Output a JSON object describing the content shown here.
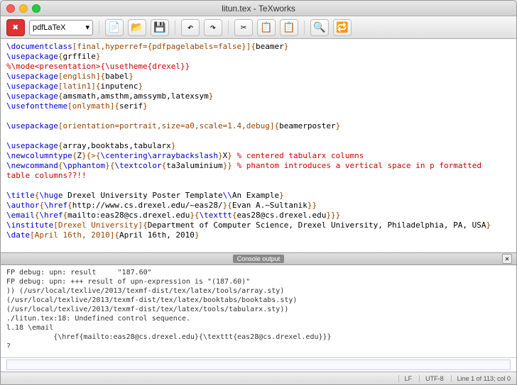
{
  "window": {
    "title": "litun.tex - TeXworks"
  },
  "toolbar": {
    "engine": "pdfLaTeX"
  },
  "editor_lines": [
    [
      {
        "t": "\\documentclass",
        "c": "cmd"
      },
      {
        "t": "[final,hyperref={pdfpagelabels=false}]{",
        "c": "struct"
      },
      {
        "t": "beamer",
        "c": ""
      },
      {
        "t": "}",
        "c": "struct"
      }
    ],
    [
      {
        "t": "\\usepackage",
        "c": "cmd"
      },
      {
        "t": "{",
        "c": "struct"
      },
      {
        "t": "grffile",
        "c": ""
      },
      {
        "t": "}",
        "c": "struct"
      }
    ],
    [
      {
        "t": "%\\mode<presentation>{\\usetheme{drexel}}",
        "c": "comment"
      }
    ],
    [
      {
        "t": "\\usepackage",
        "c": "cmd"
      },
      {
        "t": "[english]{",
        "c": "struct"
      },
      {
        "t": "babel",
        "c": ""
      },
      {
        "t": "}",
        "c": "struct"
      }
    ],
    [
      {
        "t": "\\usepackage",
        "c": "cmd"
      },
      {
        "t": "[latin1]{",
        "c": "struct"
      },
      {
        "t": "inputenc",
        "c": ""
      },
      {
        "t": "}",
        "c": "struct"
      }
    ],
    [
      {
        "t": "\\usepackage",
        "c": "cmd"
      },
      {
        "t": "{",
        "c": "struct"
      },
      {
        "t": "amsmath,amsthm,amssymb,latexsym",
        "c": ""
      },
      {
        "t": "}",
        "c": "struct"
      }
    ],
    [
      {
        "t": "\\usefonttheme",
        "c": "cmd"
      },
      {
        "t": "[onlymath]{",
        "c": "struct"
      },
      {
        "t": "serif",
        "c": ""
      },
      {
        "t": "}",
        "c": "struct"
      }
    ],
    [],
    [
      {
        "t": "\\usepackage",
        "c": "cmd"
      },
      {
        "t": "[orientation=portrait,size=a0,scale=1.4,debug]{",
        "c": "struct"
      },
      {
        "t": "beamerposter",
        "c": ""
      },
      {
        "t": "}",
        "c": "struct"
      }
    ],
    [],
    [
      {
        "t": "\\usepackage",
        "c": "cmd"
      },
      {
        "t": "{",
        "c": "struct"
      },
      {
        "t": "array,booktabs,tabularx",
        "c": ""
      },
      {
        "t": "}",
        "c": "struct"
      }
    ],
    [
      {
        "t": "\\newcolumntype",
        "c": "cmd"
      },
      {
        "t": "{",
        "c": "struct"
      },
      {
        "t": "Z",
        "c": ""
      },
      {
        "t": "}{>{",
        "c": "struct"
      },
      {
        "t": "\\centering\\arraybackslash",
        "c": "cmd"
      },
      {
        "t": "}",
        "c": "struct"
      },
      {
        "t": "X",
        "c": ""
      },
      {
        "t": "} ",
        "c": "struct"
      },
      {
        "t": "% centered tabularx columns",
        "c": "comment"
      }
    ],
    [
      {
        "t": "\\newcommand",
        "c": "cmd"
      },
      {
        "t": "{",
        "c": "struct"
      },
      {
        "t": "\\pphantom",
        "c": "cmd"
      },
      {
        "t": "}{",
        "c": "struct"
      },
      {
        "t": "\\textcolor",
        "c": "cmd"
      },
      {
        "t": "{",
        "c": "struct"
      },
      {
        "t": "ta3aluminium",
        "c": ""
      },
      {
        "t": "}} ",
        "c": "struct"
      },
      {
        "t": "% phantom introduces a vertical space in p formatted",
        "c": "comment"
      }
    ],
    [
      {
        "t": "table columns??!!",
        "c": "comment"
      }
    ],
    [],
    [
      {
        "t": "\\title",
        "c": "cmd"
      },
      {
        "t": "{",
        "c": "struct"
      },
      {
        "t": "\\huge",
        "c": "cmd"
      },
      {
        "t": " Drexel University Poster Template",
        "c": ""
      },
      {
        "t": "\\\\",
        "c": "cmd"
      },
      {
        "t": "An Example",
        "c": ""
      },
      {
        "t": "}",
        "c": "struct"
      }
    ],
    [
      {
        "t": "\\author",
        "c": "cmd"
      },
      {
        "t": "{",
        "c": "struct"
      },
      {
        "t": "\\href",
        "c": "cmd"
      },
      {
        "t": "{",
        "c": "struct"
      },
      {
        "t": "http://www.cs.drexel.edu/~eas28/",
        "c": ""
      },
      {
        "t": "}{",
        "c": "struct"
      },
      {
        "t": "Evan A.~Sultanik",
        "c": ""
      },
      {
        "t": "}}",
        "c": "struct"
      }
    ],
    [
      {
        "t": "\\email",
        "c": "cmd"
      },
      {
        "t": "{",
        "c": "struct"
      },
      {
        "t": "\\href",
        "c": "cmd"
      },
      {
        "t": "{",
        "c": "struct"
      },
      {
        "t": "mailto:eas28@cs.drexel.edu",
        "c": ""
      },
      {
        "t": "}{",
        "c": "struct"
      },
      {
        "t": "\\texttt",
        "c": "cmd"
      },
      {
        "t": "{",
        "c": "struct"
      },
      {
        "t": "eas28@cs.drexel.edu",
        "c": ""
      },
      {
        "t": "}}}",
        "c": "struct"
      }
    ],
    [
      {
        "t": "\\institute",
        "c": "cmd"
      },
      {
        "t": "[Drexel University]{",
        "c": "struct"
      },
      {
        "t": "Department of Computer Science, Drexel University, Philadelphia, PA, USA",
        "c": ""
      },
      {
        "t": "}",
        "c": "struct"
      }
    ],
    [
      {
        "t": "\\date",
        "c": "cmd"
      },
      {
        "t": "[April 16th, 2010]{",
        "c": "struct"
      },
      {
        "t": "April 16th, 2010",
        "c": ""
      },
      {
        "t": "}",
        "c": "struct"
      }
    ]
  ],
  "splitter": {
    "label": "Console output"
  },
  "console_lines": [
    "FP debug: upn: result     \"187.60\"",
    "FP debug: upn: +++ result of upn-expression is \"(187.60)\"",
    ")) (/usr/local/texlive/2013/texmf-dist/tex/latex/tools/array.sty)",
    "(/usr/local/texlive/2013/texmf-dist/tex/latex/booktabs/booktabs.sty)",
    "(/usr/local/texlive/2013/texmf-dist/tex/latex/tools/tabularx.sty))",
    "./litun.tex:18: Undefined control sequence.",
    "l.18 \\email",
    "           {\\href{mailto:eas28@cs.drexel.edu}{\\texttt{eas28@cs.drexel.edu}}}",
    "?"
  ],
  "status": {
    "lf": "LF",
    "enc": "UTF-8",
    "pos": "Line 1 of 113; col 0"
  }
}
